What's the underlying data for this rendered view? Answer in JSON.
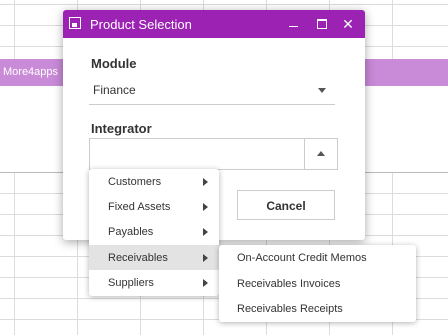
{
  "background": {
    "banner_text": "More4apps",
    "banner_color": "#c98ad8"
  },
  "dialog": {
    "title": "Product Selection",
    "titlebar_color": "#9b22b2",
    "icons": [
      "app-icon",
      "minimize-icon",
      "maximize-icon",
      "close-icon"
    ],
    "close_glyph": "✕",
    "module": {
      "label": "Module",
      "value": "Finance"
    },
    "integrator": {
      "label": "Integrator",
      "value": ""
    },
    "cancel_label": "Cancel"
  },
  "menu": {
    "items": [
      {
        "label": "Customers",
        "has_submenu": true
      },
      {
        "label": "Fixed Assets",
        "has_submenu": true
      },
      {
        "label": "Payables",
        "has_submenu": true
      },
      {
        "label": "Receivables",
        "has_submenu": true,
        "active": true
      },
      {
        "label": "Suppliers",
        "has_submenu": true
      }
    ],
    "submenu": [
      {
        "label": "On-Account Credit Memos"
      },
      {
        "label": "Receivables Invoices"
      },
      {
        "label": "Receivables Receipts"
      }
    ]
  }
}
